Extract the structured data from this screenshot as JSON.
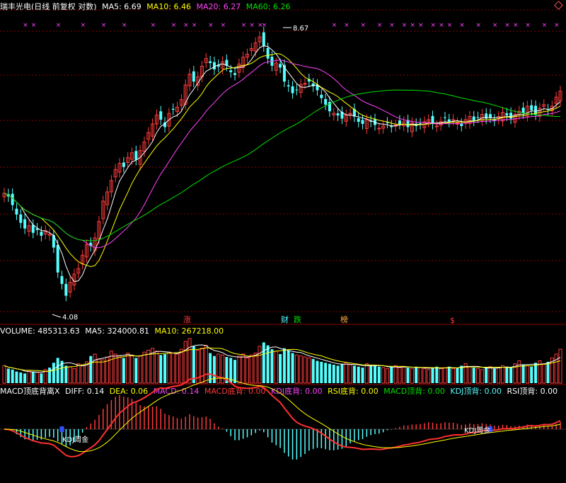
{
  "main_header": {
    "stock": "瑞丰光电(日线 前复权 对数)",
    "ma5": "MA5: 6.69",
    "ma10": "MA10: 6.46",
    "ma20": "MA20: 6.27",
    "ma60": "MA60: 6.26"
  },
  "volume_header": {
    "volume": "VOLUME: 485313.63",
    "ma5": "MA5: 324000.81",
    "ma10": "MA10: 267218.00"
  },
  "macd_header": {
    "name": "MACD顶底背离X",
    "diff": "DIFF: 0.14",
    "dea": "DEA: 0.06",
    "macd": "MACD: 0.14",
    "macd_bottom_div": "MACD底背: 0.00",
    "kdj_bottom_div": "KDJ底背: 0.00",
    "rsi_bottom_div": "RSI底背: 0.00",
    "macd_top_div": "MACD顶背: 0.00",
    "kdj_top_div": "KDJ顶背: 0.00",
    "rsi_top_div": "RSI顶背: 0.00"
  },
  "annotations": {
    "high_label": "8.67",
    "low_label": "4.08",
    "kdj_cross_1": "KDJ周金",
    "kdj_cross_2": "KDJ周金",
    "event_rise": "涨",
    "event_finance": "财",
    "event_fall": "跌",
    "event_list": "榜",
    "event_dollar": "$"
  },
  "colors": {
    "up": "#ff3b3b",
    "down": "#54ffff",
    "ma5": "#ffffff",
    "ma10": "#ffff00",
    "ma20": "#ff44ff",
    "ma60": "#00e000",
    "grid": "#8b0000"
  },
  "chart_data": [
    {
      "type": "candlestick",
      "title": "瑞丰光电 日线",
      "y_scale": "log",
      "ylim": [
        4.0,
        9.0
      ],
      "series_names": [
        "MA5",
        "MA10",
        "MA20",
        "MA60"
      ],
      "close": [
        5.6,
        5.55,
        5.42,
        5.28,
        5.16,
        5.08,
        5.12,
        5.02,
        5.06,
        4.98,
        5.05,
        5.0,
        4.82,
        4.5,
        4.36,
        4.22,
        4.38,
        4.48,
        4.55,
        4.72,
        4.86,
        4.84,
        4.95,
        5.18,
        5.48,
        5.62,
        5.8,
        5.98,
        6.08,
        6.02,
        6.18,
        6.26,
        6.14,
        6.3,
        6.45,
        6.62,
        6.78,
        6.95,
        6.86,
        6.72,
        6.98,
        7.05,
        7.1,
        7.25,
        7.55,
        7.78,
        7.62,
        7.72,
        7.95,
        8.12,
        8.02,
        7.88,
        7.94,
        8.05,
        7.96,
        7.82,
        7.76,
        8.0,
        8.15,
        8.22,
        8.35,
        8.48,
        8.62,
        8.4,
        8.12,
        7.96,
        8.02,
        7.92,
        7.62,
        7.52,
        7.38,
        7.45,
        7.56,
        7.58,
        7.62,
        7.52,
        7.44,
        7.28,
        7.15,
        7.02,
        6.98,
        6.94,
        6.88,
        6.95,
        6.98,
        6.92,
        6.82,
        6.78,
        6.86,
        6.82,
        6.76,
        6.7,
        6.74,
        6.8,
        6.72,
        6.76,
        6.78,
        6.82,
        6.72,
        6.8,
        6.74,
        6.78,
        6.82,
        6.86,
        6.78,
        6.74,
        6.82,
        6.9,
        6.82,
        6.86,
        6.8,
        6.74,
        6.86,
        6.92,
        6.84,
        6.9,
        6.96,
        6.88,
        6.9,
        6.84,
        6.92,
        7.0,
        6.94,
        6.88,
        6.96,
        7.02,
        6.98,
        7.12,
        7.04,
        6.96,
        7.08,
        7.15,
        7.05,
        7.12,
        7.3,
        7.42
      ],
      "ma5_last": 6.69,
      "ma10_last": 6.46,
      "ma20_last": 6.27,
      "ma60_last": 6.26,
      "high_marker": 8.67,
      "low_marker": 4.08
    },
    {
      "type": "bar",
      "title": "VOLUME",
      "last_value": 485313.63,
      "ma5_last": 324000.81,
      "ma10_last": 267218.0,
      "values": [
        180,
        150,
        140,
        120,
        110,
        100,
        130,
        120,
        110,
        100,
        140,
        160,
        210,
        260,
        230,
        180,
        170,
        150,
        200,
        190,
        220,
        280,
        300,
        250,
        240,
        270,
        330,
        300,
        280,
        260,
        310,
        290,
        260,
        280,
        320,
        340,
        360,
        330,
        290,
        300,
        320,
        310,
        300,
        350,
        430,
        460,
        380,
        340,
        360,
        390,
        310,
        280,
        300,
        290,
        270,
        260,
        240,
        280,
        300,
        260,
        290,
        310,
        380,
        420,
        390,
        350,
        330,
        300,
        360,
        340,
        310,
        290,
        280,
        270,
        260,
        250,
        230,
        220,
        210,
        200,
        190,
        180,
        200,
        210,
        190,
        180,
        170,
        160,
        200,
        190,
        180,
        170,
        160,
        150,
        170,
        180,
        160,
        170,
        160,
        150,
        170,
        160,
        150,
        140,
        160,
        170,
        150,
        160,
        170,
        150,
        160,
        180,
        200,
        170,
        160,
        150,
        140,
        160,
        170,
        150,
        160,
        180,
        170,
        160,
        200,
        230,
        190,
        180,
        170,
        210,
        230,
        200,
        220,
        260,
        300,
        350
      ]
    },
    {
      "type": "bar",
      "title": "MACD顶底背离X",
      "diff_last": 0.14,
      "dea_last": 0.06,
      "macd_last": 0.14,
      "series_names": [
        "DIFF",
        "DEA",
        "MACD"
      ]
    }
  ]
}
